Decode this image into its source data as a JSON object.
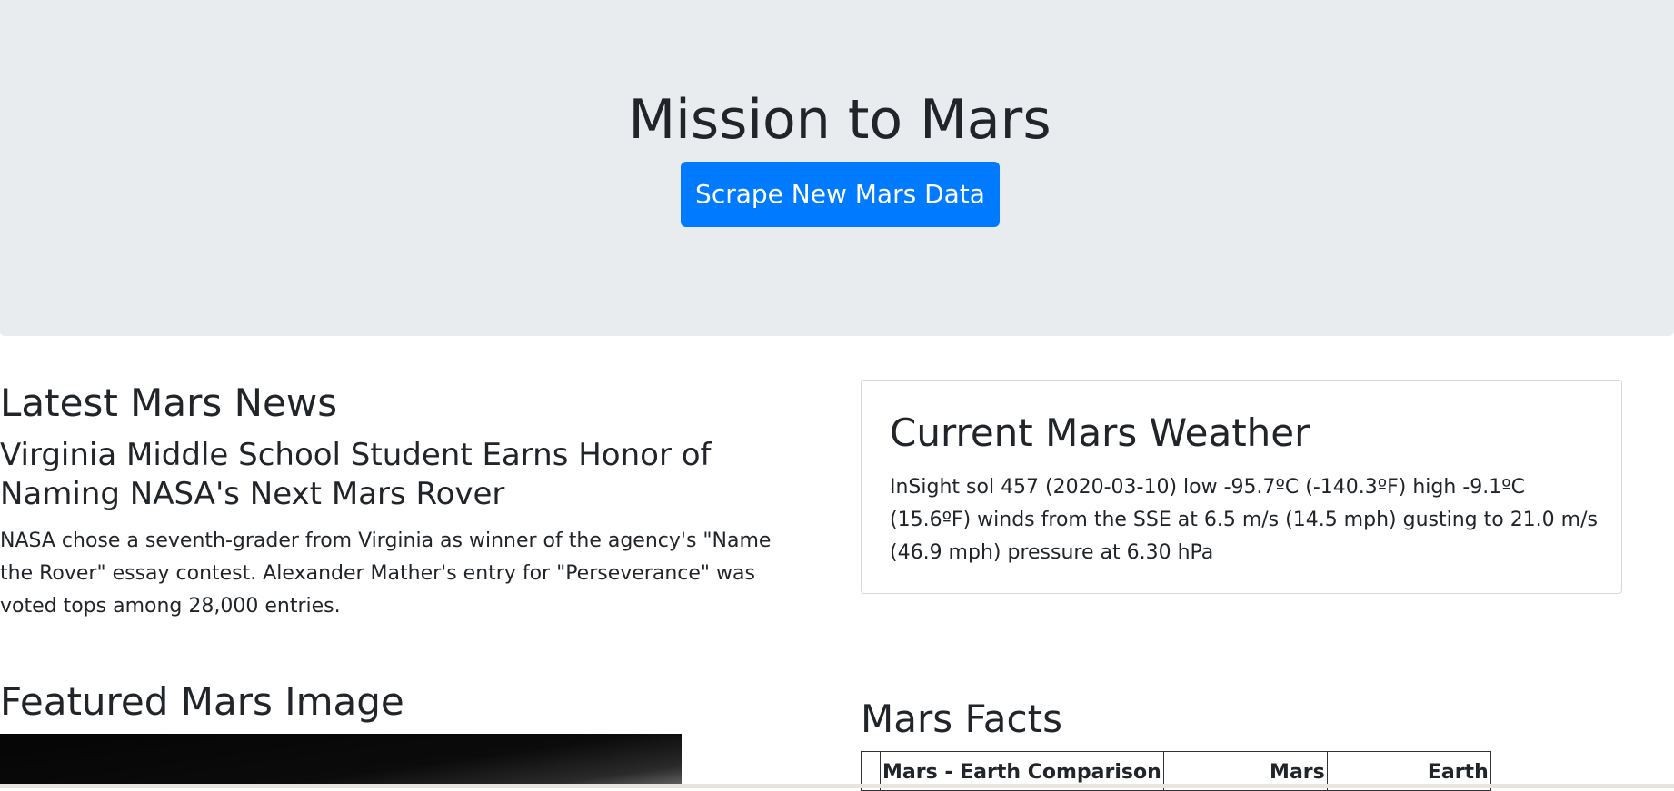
{
  "header": {
    "title": "Mission to Mars",
    "scrape_button_label": "Scrape New Mars Data",
    "button_color": "#007bff",
    "background_color": "#e9ecef"
  },
  "news": {
    "section_title": "Latest Mars News",
    "headline": "Virginia Middle School Student Earns Honor of Naming NASA's Next Mars Rover",
    "teaser": "NASA chose a seventh-grader from Virginia as winner of the agency's \"Name the Rover\" essay contest. Alexander Mather's entry for \"Perseverance\" was voted tops among 28,000 entries."
  },
  "weather": {
    "section_title": "Current Mars Weather",
    "report": "InSight sol 457 (2020-03-10) low -95.7ºC (-140.3ºF) high -9.1ºC (15.6ºF) winds from the SSE at 6.5 m/s (14.5 mph) gusting to 21.0 m/s (46.9 mph) pressure at 6.30 hPa"
  },
  "featured_image": {
    "section_title": "Featured Mars Image"
  },
  "facts": {
    "section_title": "Mars Facts",
    "columns": [
      "",
      "Mars - Earth Comparison",
      "Mars",
      "Earth"
    ]
  }
}
